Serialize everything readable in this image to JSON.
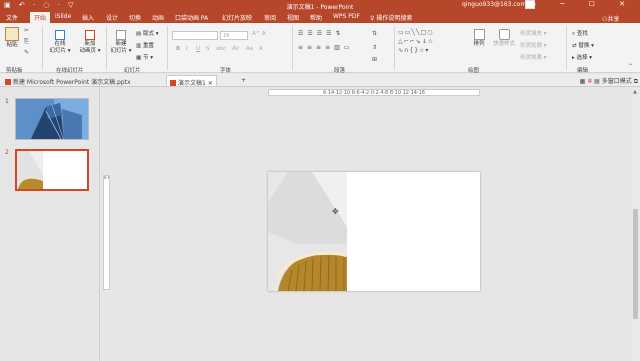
{
  "titlebar": {
    "qat": "▣ ↶ · ◌ · ▽",
    "title": "演示文稿1 - PowerPoint",
    "account": "qinguo933@163.com",
    "buttons": "▭ ─ ☐ ✕"
  },
  "tabs": [
    {
      "label": "文件"
    },
    {
      "label": "开始"
    },
    {
      "label": "iSlide"
    },
    {
      "label": "插入"
    },
    {
      "label": "设计"
    },
    {
      "label": "切换"
    },
    {
      "label": "动画"
    },
    {
      "label": "口袋动画 PA"
    },
    {
      "label": "幻灯片放映"
    },
    {
      "label": "审阅"
    },
    {
      "label": "视图"
    },
    {
      "label": "帮助"
    },
    {
      "label": "WPS PDF"
    }
  ],
  "tellme": "操作说明搜索",
  "share": "共享",
  "ribbon": {
    "paste": "粘贴",
    "clipboard": "剪贴板",
    "online1": "在线",
    "online2": "幻灯片 ▾",
    "new_anim1": "新加",
    "new_anim2": "动画页 ▾",
    "online_group": "在线幻灯片",
    "new_slide1": "新建",
    "new_slide2": "幻灯片 ▾",
    "layout": "版式 ▾",
    "reset": "重置",
    "section": "节 ▾",
    "slides_group": "幻灯片",
    "font_size": "18",
    "font_group": "字体",
    "bold": "B",
    "italic": "I",
    "underline": "U",
    "strike": "S",
    "shadow": "abc",
    "spacing": "AV",
    "case": "Aa",
    "clear": "A",
    "grow": "A^",
    "shrink": "A",
    "para_group": "段落",
    "shapes": "▭▭╲╲□○\n△⌐⌐↘↓☆\n∿∩{}☆▾",
    "arrange": "排列",
    "quick_style": "快速样式",
    "shape_fill": "形状填充 ▾",
    "shape_outline": "形状轮廓 ▾",
    "shape_effect": "形状效果 ▾",
    "drawing_group": "绘图",
    "find": "查找",
    "replace": "替换 ▾",
    "select": "选择 ▾",
    "edit_group": "编辑"
  },
  "doctabs": [
    {
      "label": "新建 Microsoft PowerPoint 演示文稿.pptx"
    },
    {
      "label": "演示文稿1"
    }
  ],
  "doc_add": "+",
  "multi_window": "多窗口模式",
  "panel": {
    "slides": [
      {
        "num": "1"
      },
      {
        "num": "2"
      }
    ]
  },
  "hruler": "6·14·12·10·8·6·4·2·0·2·4·6·8·10·12·14·16",
  "vruler": "8·6·4·2·0·2·4·6·8",
  "colors": {
    "accent": "#b7472a",
    "selected": "#d24726"
  }
}
